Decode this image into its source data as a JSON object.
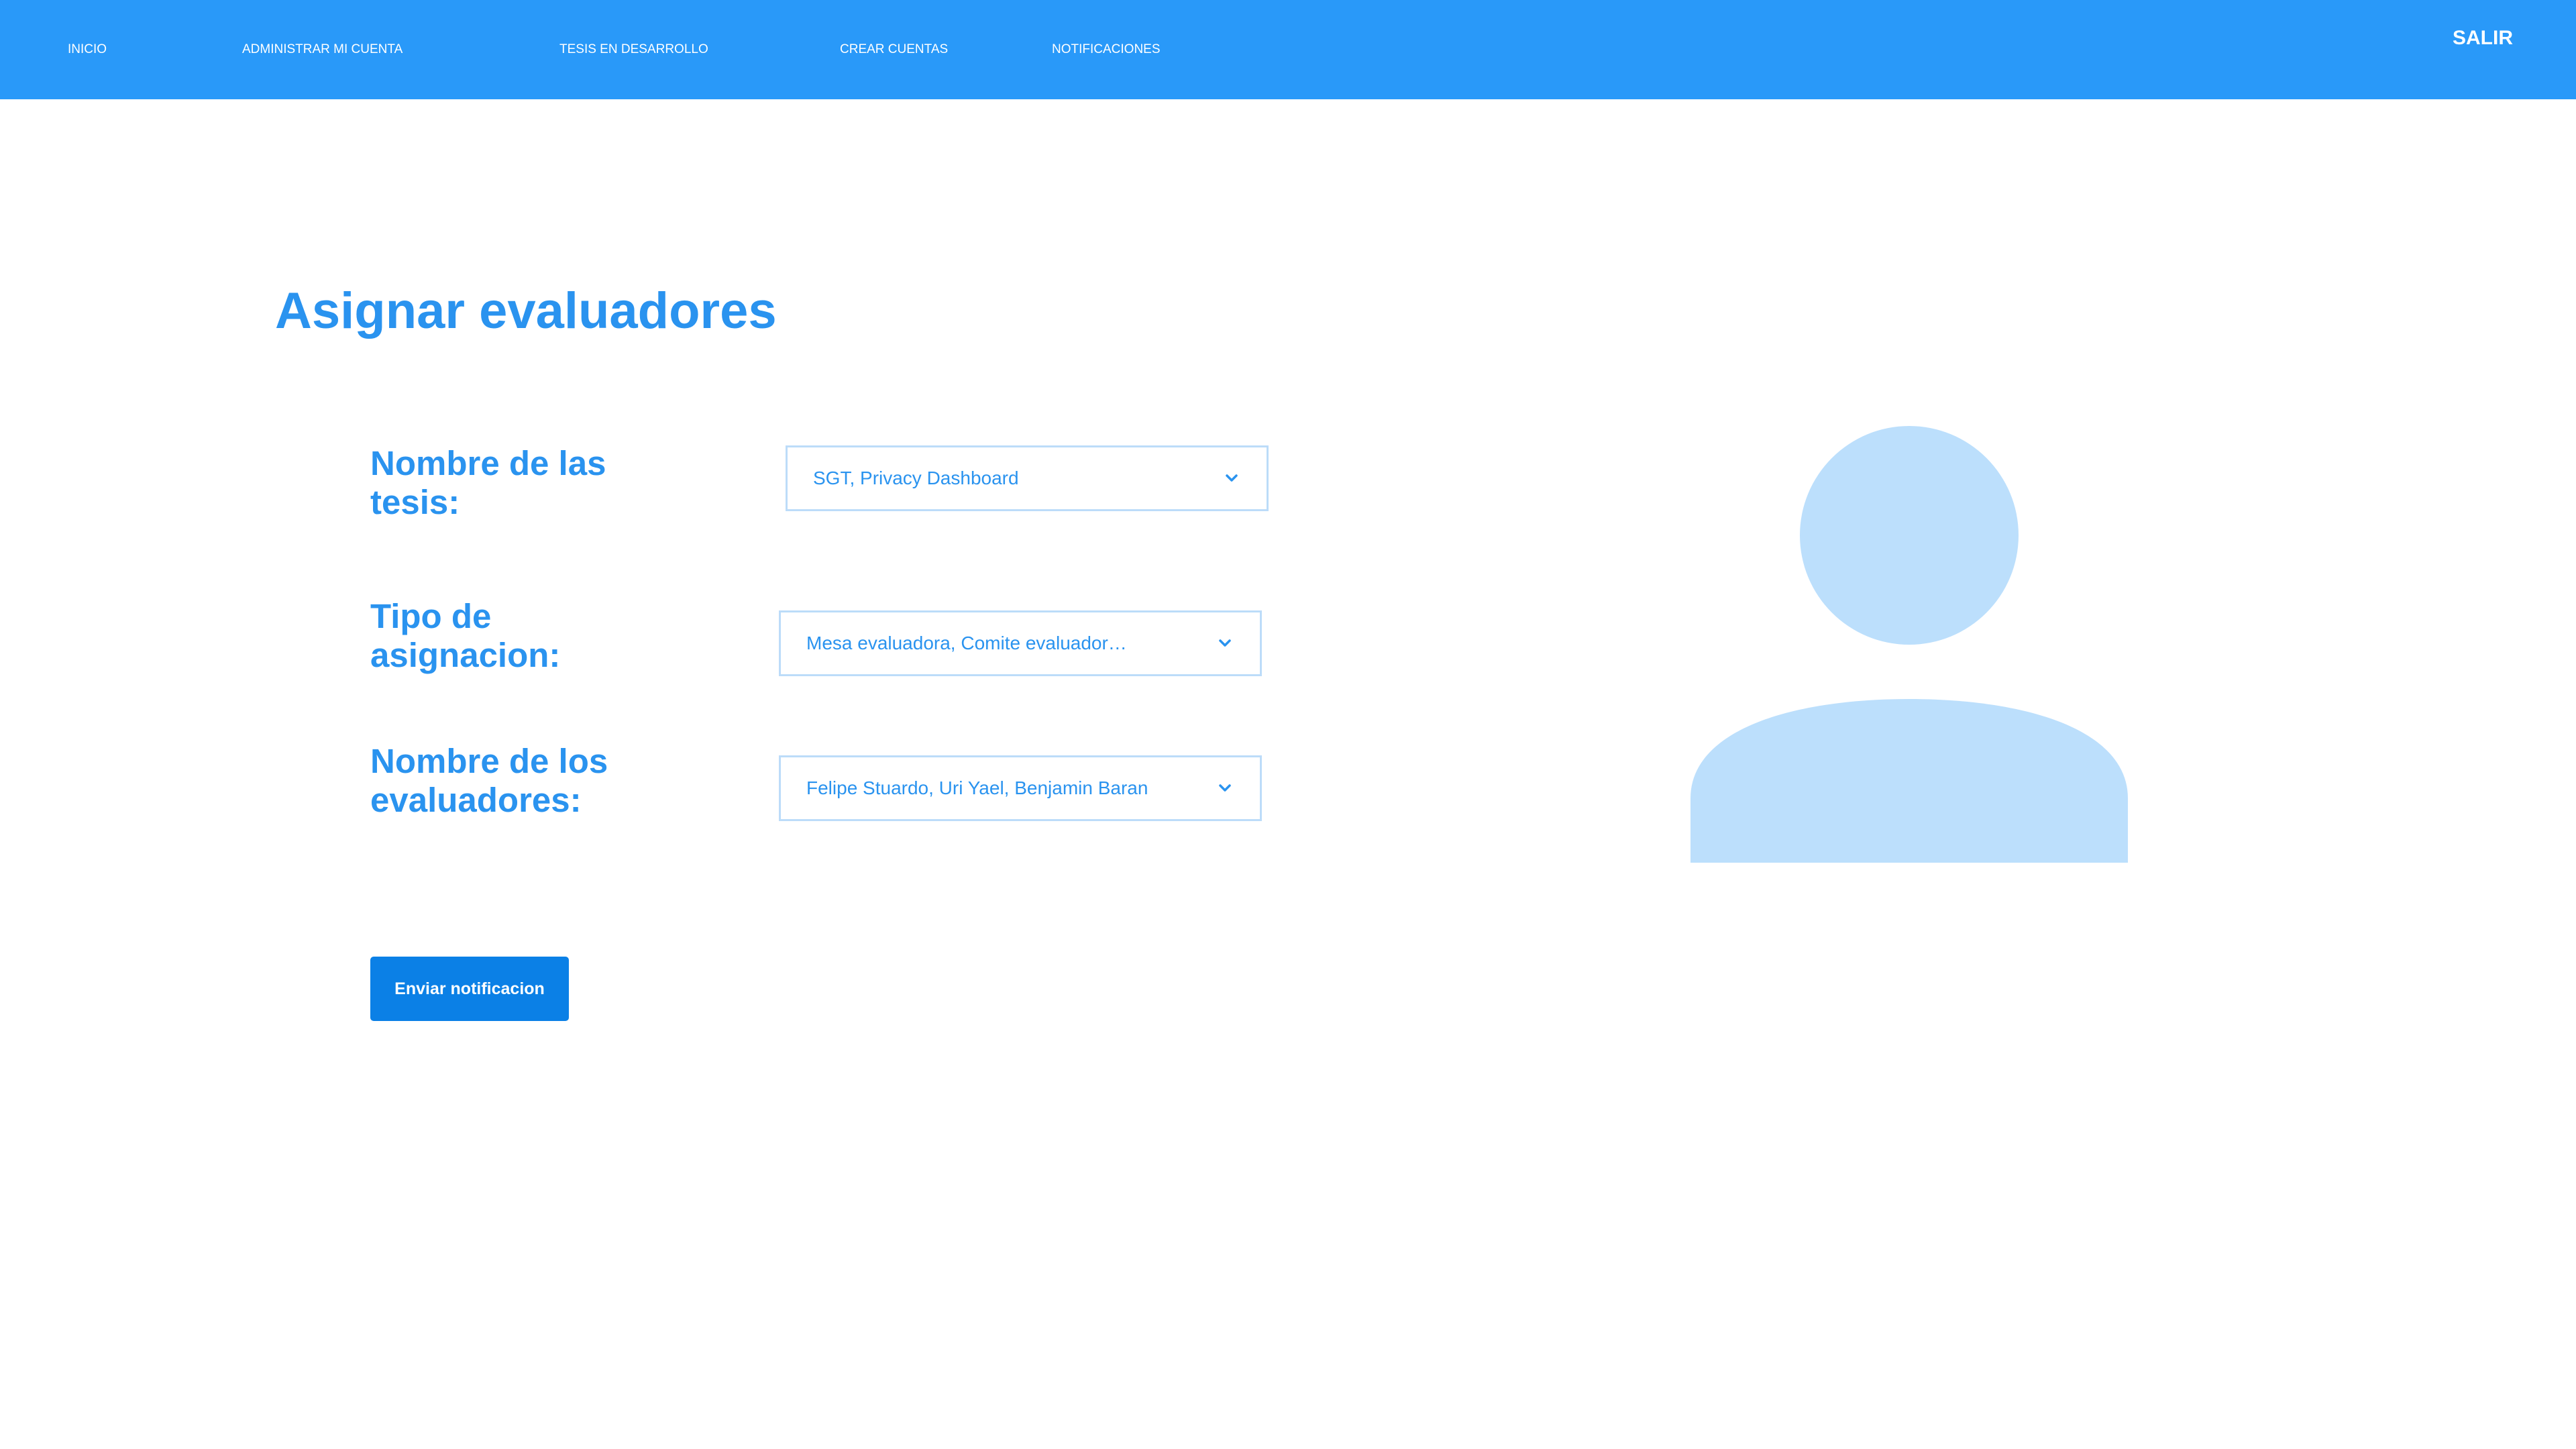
{
  "nav": {
    "items": [
      {
        "label": "INICIO"
      },
      {
        "label": "ADMINISTRAR MI CUENTA"
      },
      {
        "label": "TESIS EN DESARROLLO"
      },
      {
        "label": "CREAR CUENTAS"
      },
      {
        "label": "NOTIFICACIONES"
      }
    ],
    "logout_label": "SALIR"
  },
  "page": {
    "title": "Asignar evaluadores"
  },
  "form": {
    "thesis_label": "Nombre de las tesis:",
    "thesis_value": "SGT, Privacy Dashboard",
    "assignment_label": "Tipo de asignacion:",
    "assignment_value": "Mesa evaluadora, Comite evaluador…",
    "evaluators_label": "Nombre de los evaluadores:",
    "evaluators_value": "Felipe Stuardo, Uri Yael, Benjamin Baran",
    "submit_label": "Enviar notificacion"
  },
  "icons": {
    "dropdown": "chevron-down-icon",
    "avatar": "user-avatar-icon"
  },
  "colors": {
    "topbar": "#2999f9",
    "accent_text": "#2a93ef",
    "button": "#0b80e6",
    "field_border": "#bcdcf9",
    "avatar": "#bcdffc"
  }
}
